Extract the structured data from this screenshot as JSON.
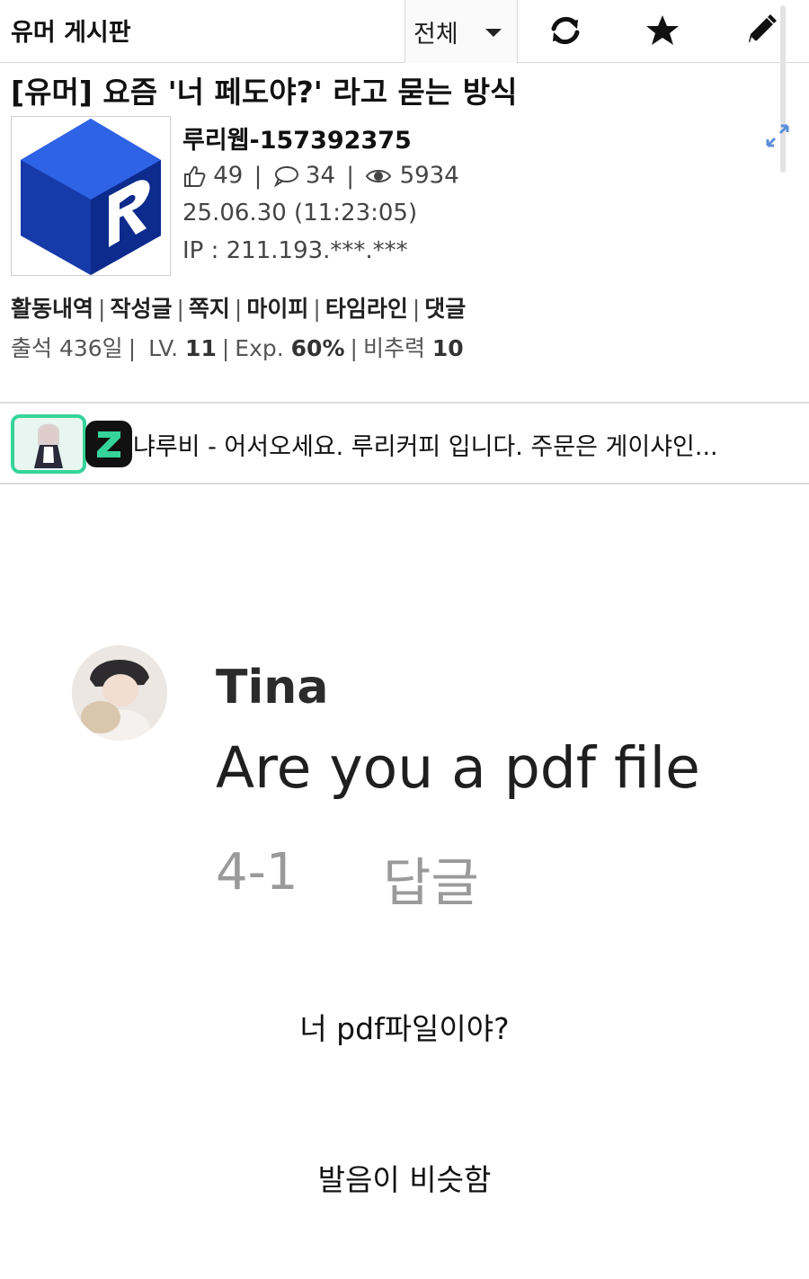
{
  "topbar": {
    "board_title": "유머 게시판",
    "filter_value": "전체",
    "icons": [
      "refresh-icon",
      "star-icon",
      "pencil-icon"
    ]
  },
  "post": {
    "title": "[유머] 요즘 '너 페도야?' 라고 묻는 방식",
    "author": "루리웹-157392375",
    "likes": "49",
    "comments": "34",
    "views": "5934",
    "date": "25.06.30 (11:23:05)",
    "ip": "IP : 211.193.***.***"
  },
  "user_links": [
    "활동내역",
    "작성글",
    "쪽지",
    "마이피",
    "타임라인",
    "댓글"
  ],
  "user_stats": {
    "attendance_label": "출석",
    "attendance_value": "436일",
    "level_label": "LV.",
    "level_value": "11",
    "exp_label": "Exp.",
    "exp_value": "60%",
    "power_label": "비추력",
    "power_value": "10"
  },
  "notice": {
    "badge_letter": "Z",
    "text": "냐루비 - 어서오세요. 루리커피 입니다. 주문은 게이샤인..."
  },
  "embedded_comment": {
    "name": "Tina",
    "comment": "Are you a pdf file",
    "date": "4-1",
    "reply_label": "답글"
  },
  "body": {
    "line1": "너 pdf파일이야?",
    "line2": "발음이 비슷함"
  },
  "colors": {
    "accent_green": "#35d49a",
    "logo_blue": "#1e4fd6",
    "divider": "#dcdcdc"
  }
}
